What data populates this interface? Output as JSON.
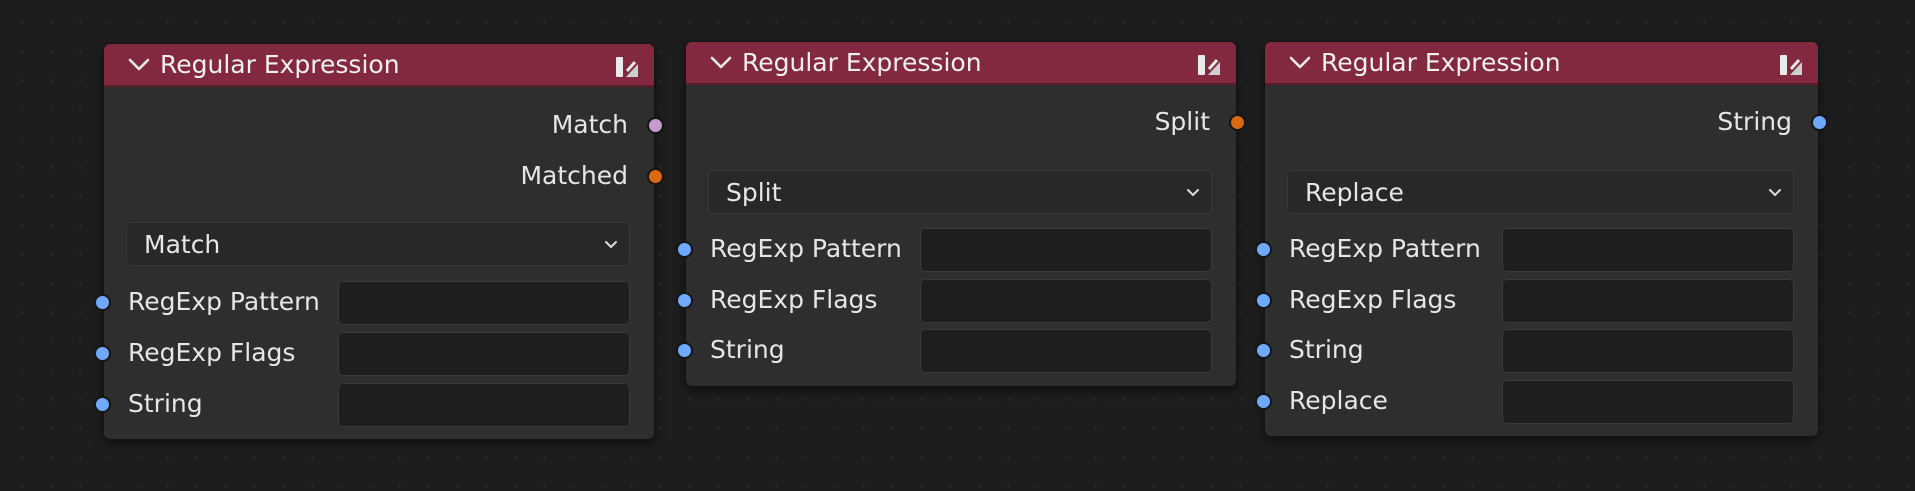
{
  "nodes": [
    {
      "title": "Regular Expression",
      "outputs": [
        {
          "label": "Match",
          "color": "purple"
        },
        {
          "label": "Matched",
          "color": "orange"
        }
      ],
      "mode": "Match",
      "inputs": [
        {
          "label": "RegExp Pattern",
          "value": ""
        },
        {
          "label": "RegExp Flags",
          "value": ""
        },
        {
          "label": "String",
          "value": ""
        }
      ]
    },
    {
      "title": "Regular Expression",
      "outputs": [
        {
          "label": "Split",
          "color": "orange"
        }
      ],
      "mode": "Split",
      "inputs": [
        {
          "label": "RegExp Pattern",
          "value": ""
        },
        {
          "label": "RegExp Flags",
          "value": ""
        },
        {
          "label": "String",
          "value": ""
        }
      ]
    },
    {
      "title": "Regular Expression",
      "outputs": [
        {
          "label": "String",
          "color": "blue"
        }
      ],
      "mode": "Replace",
      "inputs": [
        {
          "label": "RegExp Pattern",
          "value": ""
        },
        {
          "label": "RegExp Flags",
          "value": ""
        },
        {
          "label": "String",
          "value": ""
        },
        {
          "label": "Replace",
          "value": ""
        }
      ]
    }
  ],
  "colors": {
    "header": "#83293f",
    "node_body": "#2e2e2e",
    "canvas": "#1d1d1d",
    "socket_blue": "#6ea9ff",
    "socket_purple": "#c999d1",
    "socket_orange": "#d9680e"
  },
  "icons": {
    "collapse": "chevron-down-icon",
    "preview": "node-preview-icon",
    "dropdown": "chevron-down-icon"
  }
}
